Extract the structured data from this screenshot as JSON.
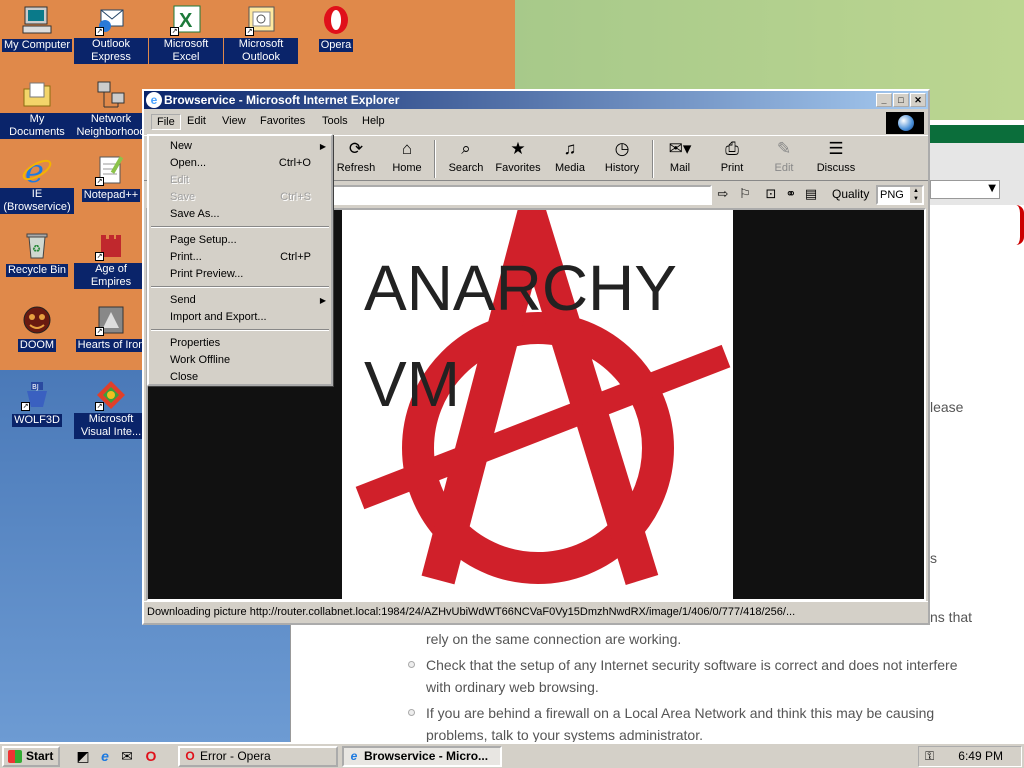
{
  "desktop": {
    "icons": [
      {
        "label": "My Computer",
        "icon": "computer-icon"
      },
      {
        "label": "Outlook Express",
        "icon": "outlook-express-icon"
      },
      {
        "label": "Microsoft Excel",
        "icon": "excel-icon"
      },
      {
        "label": "Microsoft Outlook",
        "icon": "outlook-icon"
      },
      {
        "label": "Opera",
        "icon": "opera-icon"
      },
      {
        "label": "My Documents",
        "icon": "folder-icon"
      },
      {
        "label": "Network Neighborhood",
        "icon": "network-icon"
      },
      {
        "label": "IE (Browservice)",
        "icon": "ie-icon"
      },
      {
        "label": "Notepad++",
        "icon": "notepad-icon"
      },
      {
        "label": "Recycle Bin",
        "icon": "recycle-bin-icon"
      },
      {
        "label": "Age of Empires",
        "icon": "age-of-empires-icon"
      },
      {
        "label": "DOOM",
        "icon": "doom-icon"
      },
      {
        "label": "Hearts of Iron",
        "icon": "hearts-of-iron-icon"
      },
      {
        "label": "WOLF3D",
        "icon": "wolf3d-icon"
      },
      {
        "label": "Microsoft Visual Inte...",
        "icon": "visual-interdev-icon"
      }
    ]
  },
  "opera_background": {
    "text_lease": "lease",
    "text_s": "s",
    "text_ns_that": "ns that",
    "line1": "rely on the same connection are working.",
    "bullet1_line1": "Check that the setup of any Internet security software is correct and does not interfere",
    "bullet1_line2": "with ordinary web browsing.",
    "bullet2_line1": "If you are behind a firewall on a Local Area Network and think this may be causing",
    "bullet2_line2": "problems, talk to your systems administrator."
  },
  "ie_window": {
    "title": "Browservice - Microsoft Internet Explorer",
    "menus": [
      "File",
      "Edit",
      "View",
      "Favorites",
      "Tools",
      "Help"
    ],
    "toolbar": [
      {
        "label": "Refresh",
        "icon": "refresh-icon"
      },
      {
        "label": "Home",
        "icon": "home-icon"
      },
      {
        "label": "Search",
        "icon": "search-icon"
      },
      {
        "label": "Favorites",
        "icon": "favorites-icon"
      },
      {
        "label": "Media",
        "icon": "media-icon"
      },
      {
        "label": "History",
        "icon": "history-icon"
      },
      {
        "label": "Mail",
        "icon": "mail-icon"
      },
      {
        "label": "Print",
        "icon": "print-icon"
      },
      {
        "label": "Edit",
        "icon": "edit-icon"
      },
      {
        "label": "Discuss",
        "icon": "discuss-icon"
      }
    ],
    "quality_label": "Quality",
    "quality_value": "PNG",
    "content_text_line1": "ANARCHY",
    "content_text_line2": "VM",
    "status": "Downloading picture http://router.collabnet.local:1984/24/AZHvUbiWdWT66NCVaF0Vy15DmzhNwdRX/image/1/406/0/777/418/256/..."
  },
  "file_menu": {
    "items": [
      {
        "label": "New",
        "shortcut": "",
        "submenu": true,
        "disabled": false
      },
      {
        "label": "Open...",
        "shortcut": "Ctrl+O",
        "submenu": false,
        "disabled": false
      },
      {
        "label": "Edit",
        "shortcut": "",
        "submenu": false,
        "disabled": true
      },
      {
        "label": "Save",
        "shortcut": "Ctrl+S",
        "submenu": false,
        "disabled": true
      },
      {
        "label": "Save As...",
        "shortcut": "",
        "submenu": false,
        "disabled": false
      },
      {
        "label": "Page Setup...",
        "shortcut": "",
        "submenu": false,
        "disabled": false
      },
      {
        "label": "Print...",
        "shortcut": "Ctrl+P",
        "submenu": false,
        "disabled": false
      },
      {
        "label": "Print Preview...",
        "shortcut": "",
        "submenu": false,
        "disabled": false
      },
      {
        "label": "Send",
        "shortcut": "",
        "submenu": true,
        "disabled": false
      },
      {
        "label": "Import and Export...",
        "shortcut": "",
        "submenu": false,
        "disabled": false
      },
      {
        "label": "Properties",
        "shortcut": "",
        "submenu": false,
        "disabled": false
      },
      {
        "label": "Work Offline",
        "shortcut": "",
        "submenu": false,
        "disabled": false
      },
      {
        "label": "Close",
        "shortcut": "",
        "submenu": false,
        "disabled": false
      }
    ]
  },
  "taskbar": {
    "start_label": "Start",
    "tasks": [
      {
        "label": "Error - Opera",
        "icon": "opera-icon",
        "active": false
      },
      {
        "label": "Browservice - Micro...",
        "icon": "ie-icon",
        "active": true
      }
    ],
    "clock": "6:49 PM"
  },
  "colors": {
    "title_bar": "#0a246a",
    "anarchy_red": "#d0202a",
    "window_face": "#d4d0c8"
  }
}
